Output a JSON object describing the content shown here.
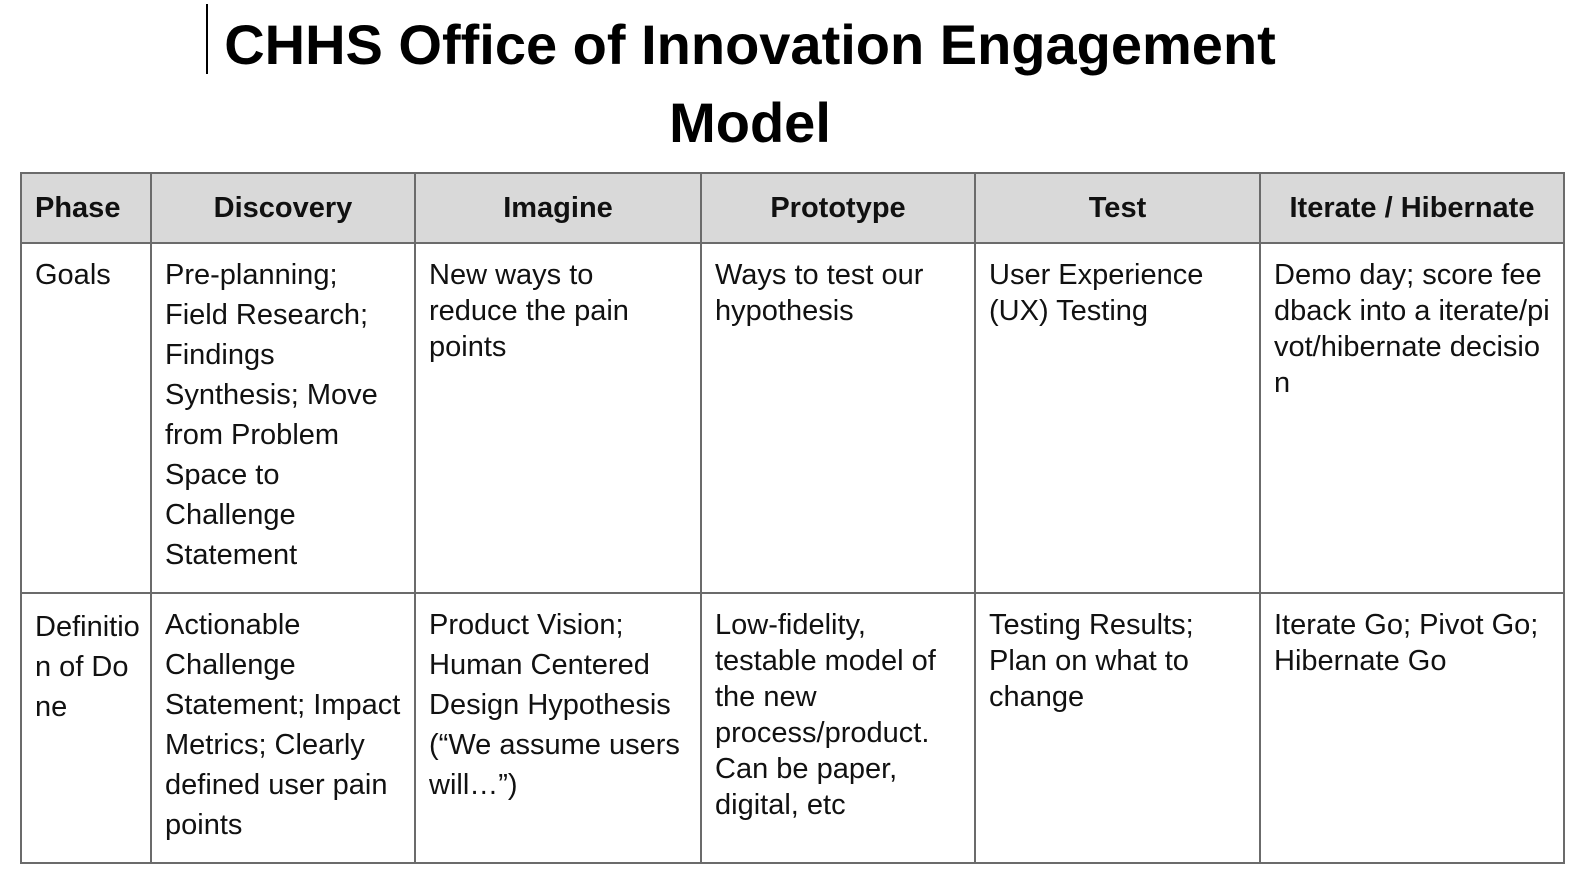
{
  "document": {
    "title": "CHHS Office of Innovation Engagement Model"
  },
  "table": {
    "headers": [
      "Phase",
      "Discovery",
      "Imagine",
      "Prototype",
      "Test",
      "Iterate / Hibernate"
    ],
    "rows": [
      {
        "label": "Goals",
        "cells": [
          "Pre-planning; Field Research; Findings Synthesis; Move from Problem Space to Challenge Statement",
          "New ways to reduce the pain points",
          "Ways to test our hypothesis",
          "User Experience (UX) Testing",
          "Demo day; score feedback into a iterate/pivot/hibernate decision"
        ]
      },
      {
        "label": "Definition of Done",
        "cells": [
          "Actionable Challenge Statement; Impact Metrics; Clearly defined user pain points",
          "Product Vision; Human Centered Design Hypothesis (“We assume users will…”)",
          "Low-fidelity, testable model of the new process/product. Can be paper, digital, etc",
          "Testing Results; Plan on what to change",
          "Iterate Go; Pivot Go; Hibernate Go"
        ]
      }
    ]
  }
}
